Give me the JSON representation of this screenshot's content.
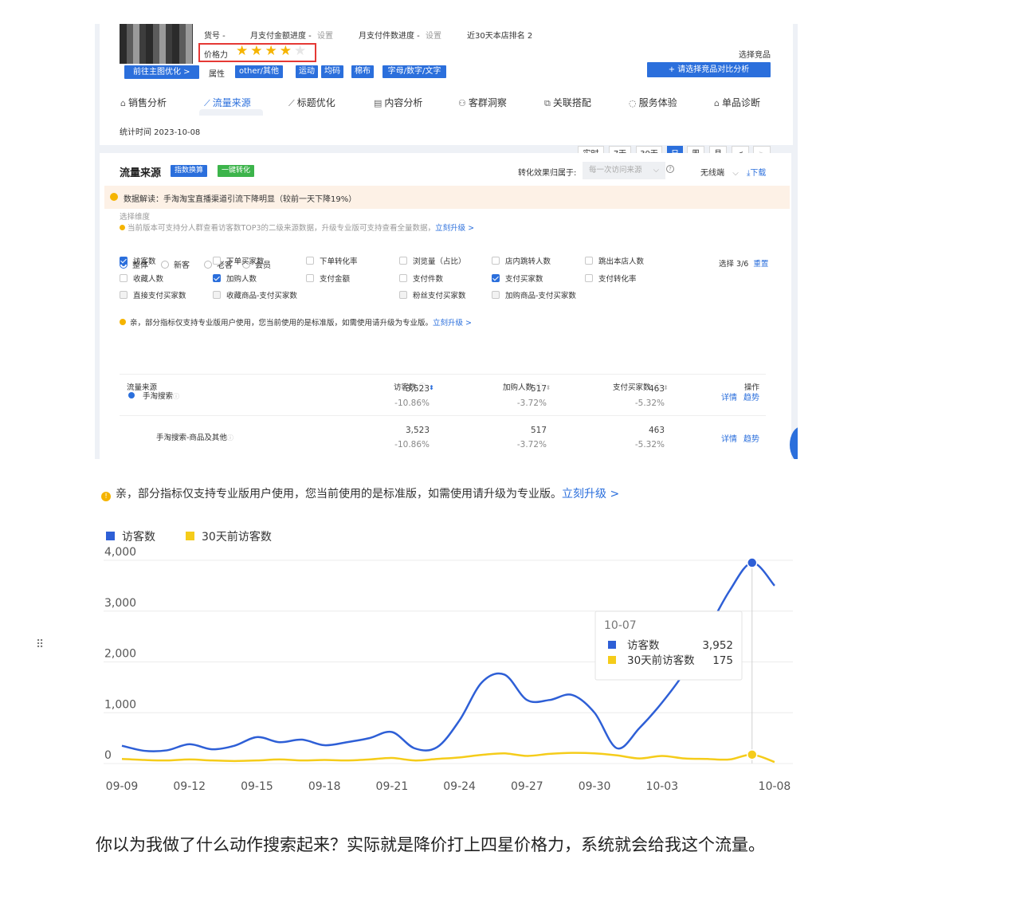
{
  "screenshot": {
    "product": {
      "item_no": "货号 -",
      "monthly_amount": "月支付金额进度 -",
      "monthly_amount_setting": "设置",
      "monthly_count": "月支付件数进度 -",
      "monthly_count_setting": "设置",
      "rank": "近30天本店排名 2",
      "price_power_label": "价格力",
      "price_power_stars": 4,
      "price_power_max": 5,
      "attr_label": "属性",
      "attr_tags": [
        "other/其他",
        "运动",
        "均码",
        "棉布",
        "字母/数字/文字"
      ],
      "optimize_button": "前往主图优化 >",
      "select_competitor": "选择竞品",
      "compare_button": "+ 请选择竞品对比分析"
    },
    "nav_tabs": [
      "销售分析",
      "流量来源",
      "标题优化",
      "内容分析",
      "客群洞察",
      "关联搭配",
      "服务体验",
      "单品诊断"
    ],
    "stat_time": "统计时间 2023-10-08",
    "periods": [
      "实时",
      "7天",
      "30天",
      "日",
      "周",
      "月",
      "<",
      ">"
    ],
    "active_period": "日",
    "traffic": {
      "title": "流量来源",
      "btn_index": "指数换算",
      "btn_convert": "一键转化",
      "attribution_label": "转化效果归属于:",
      "attribution_value": "每一次访问来源",
      "device": "无线端",
      "download": "下载",
      "insight": "数据解读：手淘淘宝直播渠道引流下降明显（较前一天下降19%）",
      "dimension_label": "选择维度",
      "version_note": "当前版本可支持分人群查看访客数TOP3的二级来源数据，升级专业版可支持查看全量数据，",
      "upgrade_now": "立刻升级 >",
      "segments": [
        "整体",
        "新客",
        "老客",
        "会员"
      ],
      "selected_count": "选择 3/6",
      "reset": "重置",
      "metrics": [
        {
          "label": "访客数",
          "state": "on"
        },
        {
          "label": "下单买家数",
          "state": "off"
        },
        {
          "label": "下单转化率",
          "state": "off"
        },
        {
          "label": "浏览量（占比）",
          "state": "off"
        },
        {
          "label": "店内跳转人数",
          "state": "off"
        },
        {
          "label": "跳出本店人数",
          "state": "off"
        },
        {
          "label": "收藏人数",
          "state": "off"
        },
        {
          "label": "加购人数",
          "state": "on"
        },
        {
          "label": "支付金额",
          "state": "off"
        },
        {
          "label": "支付件数",
          "state": "off"
        },
        {
          "label": "支付买家数",
          "state": "on"
        },
        {
          "label": "支付转化率",
          "state": "off"
        },
        {
          "label": "直接支付买家数",
          "state": "dis"
        },
        {
          "label": "收藏商品-支付买家数",
          "state": "dis"
        },
        {
          "label": "粉丝支付买家数",
          "state": "dis"
        },
        {
          "label": "加购商品-支付买家数",
          "state": "dis"
        }
      ],
      "pro_note": "亲，部分指标仅支持专业版用户使用，您当前使用的是标准版，如需使用请升级为专业版。",
      "pro_link": "立刻升级 >",
      "table": {
        "headers": [
          "流量来源",
          "访客数",
          "加购人数",
          "支付买家数",
          "操作"
        ],
        "rows": [
          {
            "source": "手淘搜索",
            "visitors": "3,523",
            "visitors_change": "-10.86%",
            "cart": "517",
            "cart_change": "-3.72%",
            "buyers": "463",
            "buyers_change": "-5.32%",
            "op1": "详情",
            "op2": "趋势"
          },
          {
            "source": "手淘搜索-商品及其他",
            "visitors": "3,523",
            "visitors_change": "-10.86%",
            "cart": "517",
            "cart_change": "-3.72%",
            "buyers": "463",
            "buyers_change": "-5.32%",
            "op1": "详情",
            "op2": "趋势"
          }
        ]
      }
    }
  },
  "notice": {
    "text": "亲，部分指标仅支持专业版用户使用，您当前使用的是标准版，如需使用请升级为专业版。",
    "link": "立刻升级 >"
  },
  "chart_data": {
    "type": "line",
    "x": [
      "09-09",
      "09-10",
      "09-11",
      "09-12",
      "09-13",
      "09-14",
      "09-15",
      "09-16",
      "09-17",
      "09-18",
      "09-19",
      "09-20",
      "09-21",
      "09-22",
      "09-23",
      "09-24",
      "09-25",
      "09-26",
      "09-27",
      "09-28",
      "09-29",
      "09-30",
      "10-01",
      "10-02",
      "10-03",
      "10-04",
      "10-05",
      "10-06",
      "10-07",
      "10-08"
    ],
    "x_ticks": [
      "09-09",
      "09-12",
      "09-15",
      "09-18",
      "09-21",
      "09-24",
      "09-27",
      "09-30",
      "10-03",
      "10-08"
    ],
    "series": [
      {
        "name": "访客数",
        "color": "#2e5fd6",
        "values": [
          350,
          250,
          260,
          380,
          280,
          350,
          520,
          420,
          470,
          360,
          420,
          500,
          620,
          300,
          320,
          850,
          1600,
          1750,
          1250,
          1250,
          1350,
          1000,
          300,
          700,
          1200,
          1800,
          2600,
          3400,
          3952,
          3500
        ]
      },
      {
        "name": "30天前访客数",
        "color": "#f5cc1a",
        "values": [
          90,
          70,
          60,
          80,
          60,
          50,
          60,
          80,
          60,
          70,
          60,
          80,
          110,
          60,
          90,
          120,
          170,
          200,
          150,
          190,
          210,
          200,
          160,
          100,
          150,
          100,
          90,
          80,
          175,
          30
        ]
      }
    ],
    "y_ticks": [
      "0",
      "1,000",
      "2,000",
      "3,000",
      "4,000"
    ],
    "ylim": [
      0,
      4000
    ],
    "grid": true,
    "legend_position": "top-left",
    "tooltip": {
      "date": "10-07",
      "rows": [
        {
          "name": "访客数",
          "value": "3,952"
        },
        {
          "name": "30天前访客数",
          "value": "175"
        }
      ]
    }
  },
  "caption": "你以为我做了什么动作搜索起来？实际就是降价打上四星价格力，系统就会给我这个流量。",
  "drag_handle_icon": "drag-handle-icon"
}
